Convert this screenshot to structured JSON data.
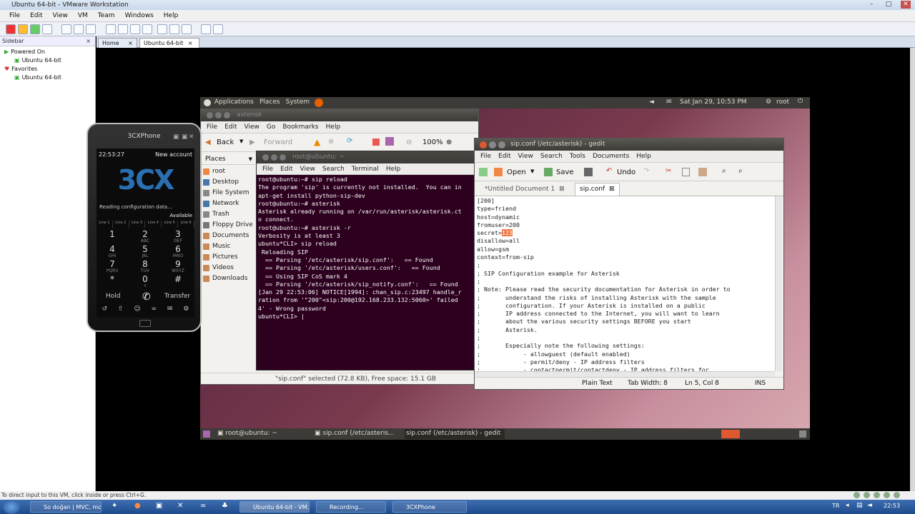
{
  "vmware": {
    "title": "Ubuntu 64-bit - VMware Workstation",
    "menu": [
      "File",
      "Edit",
      "View",
      "VM",
      "Team",
      "Windows",
      "Help"
    ],
    "sidebar_header": "Sidebar",
    "sidebar_close": "×",
    "tree": [
      {
        "label": "Powered On",
        "indent": 0
      },
      {
        "label": "Ubuntu 64-bit",
        "indent": 1
      },
      {
        "label": "Favorites",
        "indent": 0
      },
      {
        "label": "Ubuntu 64-bit",
        "indent": 1
      }
    ],
    "tabs": [
      "Home",
      "Ubuntu 64-bit"
    ],
    "status": "To direct input to this VM, click inside or press Ctrl+G."
  },
  "ubuntu": {
    "panel_menu": [
      "Applications",
      "Places",
      "System"
    ],
    "clock": "Sat Jan 29, 10:53 PM",
    "user": "root",
    "bottom_tasks": [
      "root@ubuntu: ~",
      "sip.conf (/etc/asteris...",
      "sip.conf (/etc/asterisk) - gedit"
    ]
  },
  "nautilus": {
    "title": "asterisk",
    "menu": [
      "File",
      "Edit",
      "View",
      "Go",
      "Bookmarks",
      "Help"
    ],
    "back": "Back",
    "forward": "Forward",
    "zoom": "100%",
    "places_label": "Places",
    "places": [
      "root",
      "Desktop",
      "File System",
      "Network",
      "Trash",
      "Floppy Drive",
      "Documents",
      "Music",
      "Pictures",
      "Videos",
      "Downloads"
    ],
    "status": "\"sip.conf\" selected (72.8 KB), Free space: 15.1 GB"
  },
  "terminal": {
    "title": "root@ubuntu: ~",
    "menu": [
      "File",
      "Edit",
      "View",
      "Search",
      "Terminal",
      "Help"
    ],
    "lines": [
      "root@ubuntu:~# sip reload",
      "The program 'sip' is currently not installed.  You can in",
      "apt-get install python-sip-dev",
      "root@ubuntu:~# asterisk",
      "Asterisk already running on /var/run/asterisk/asterisk.ct",
      "o connect.",
      "root@ubuntu:~# asterisk -r",
      "Verbosity is at least 3",
      "ubuntu*CLI> sip reload",
      " Reloading SIP",
      "  == Parsing '/etc/asterisk/sip.conf':   == Found",
      "  == Parsing '/etc/asterisk/users.conf':   == Found",
      "  == Using SIP CoS mark 4",
      "  == Parsing '/etc/asterisk/sip_notify.conf':   == Found",
      "[Jan 29 22:53:06] NOTICE[1994]: chan_sip.c:23497 handle_r",
      "ration from '\"200\"<sip:200@192.168.233.132:5060>' failed",
      "4' - Wrong password",
      "ubuntu*CLI> |"
    ]
  },
  "gedit": {
    "title": "sip.conf (/etc/asterisk) - gedit",
    "menu": [
      "File",
      "Edit",
      "View",
      "Search",
      "Tools",
      "Documents",
      "Help"
    ],
    "toolbar": {
      "open": "Open",
      "save": "Save",
      "undo": "Undo"
    },
    "tabs": [
      "*Untitled Document 1",
      "sip.conf"
    ],
    "lines": [
      "[200]",
      "type=friend",
      "host=dynamic",
      "fromuser=200",
      "secret=123",
      "disallow=all",
      "allow=gsm",
      "context=from-sip",
      ";",
      "; SIP Configuration example for Asterisk",
      ";",
      "; Note: Please read the security documentation for Asterisk in order to",
      ";       understand the risks of installing Asterisk with the sample",
      ";       configuration. If your Asterisk is installed on a public",
      ";       IP address connected to the Internet, you will want to learn",
      ";       about the various security settings BEFORE you start",
      ";       Asterisk.",
      ";",
      ";       Especially note the following settings:",
      ";            - allowguest (default enabled)",
      ";            - permit/deny - IP address filters",
      ";            - contactpermit/contactdeny - IP address filters for"
    ],
    "status": {
      "lang": "Plain Text",
      "tab": "Tab Width: 8",
      "pos": "Ln 5, Col 8",
      "mode": "INS"
    }
  },
  "phone": {
    "title": "3CXPhone",
    "time": "22:53:27",
    "account": "New account",
    "logo": "3CX",
    "status": "Reading configuration data...",
    "availability": "Available",
    "lines": [
      "Line 1",
      "Line 2",
      "Line 3",
      "Line 4",
      "Line 5",
      "Line 6"
    ],
    "keys": [
      {
        "d": "1",
        "l": ""
      },
      {
        "d": "2",
        "l": "ABC"
      },
      {
        "d": "3",
        "l": "DEF"
      },
      {
        "d": "4",
        "l": "GHI"
      },
      {
        "d": "5",
        "l": "JKL"
      },
      {
        "d": "6",
        "l": "MNO"
      },
      {
        "d": "7",
        "l": "PQRS"
      },
      {
        "d": "8",
        "l": "TUV"
      },
      {
        "d": "9",
        "l": "WXYZ"
      },
      {
        "d": "*",
        "l": ""
      },
      {
        "d": "0",
        "l": "+"
      },
      {
        "d": "#",
        "l": ""
      }
    ],
    "hold": "Hold",
    "transfer": "Transfer"
  },
  "taskbar": {
    "items": [
      "So doğan | MVC, mc...",
      "Ubuntu 64-bit - VM...",
      "Recording...",
      "3CXPhone"
    ],
    "lang": "TR",
    "clock": "22:53"
  }
}
